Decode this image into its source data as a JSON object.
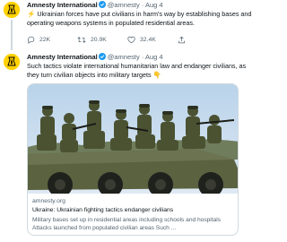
{
  "tweets": [
    {
      "author": "Amnesty International",
      "handle": "@amnesty",
      "separator": "·",
      "time": "Aug 4",
      "text_emoji": "⚡",
      "text": " Ukrainian forces have put civilians in harm's way by establishing bases and operating weapons systems in populated residential areas.",
      "replies": "22K",
      "retweets": "20.9K",
      "likes": "32.4K"
    },
    {
      "author": "Amnesty International",
      "handle": "@amnesty",
      "separator": "·",
      "time": "Aug 4",
      "text": "Such tactics violate international humanitarian law and endanger civilians, as they turn civilian objects into military targets ",
      "text_emoji": "👇",
      "card": {
        "domain": "amnesty.org",
        "title": "Ukraine: Ukrainian fighting tactics endanger civilians",
        "description": "Military bases set up in residential areas including schools and hospitals  Attacks launched from populated civilian areas Such ..."
      }
    }
  ],
  "icons": {
    "avatar": "amnesty-candle-logo",
    "verified": "verified-badge-icon",
    "reply": "reply-icon",
    "retweet": "retweet-icon",
    "like": "heart-icon",
    "share": "share-icon"
  },
  "colors": {
    "brand_yellow": "#ffd200",
    "verified_blue": "#1d9bf0",
    "secondary_text": "#536471",
    "border": "#cfd9de"
  }
}
